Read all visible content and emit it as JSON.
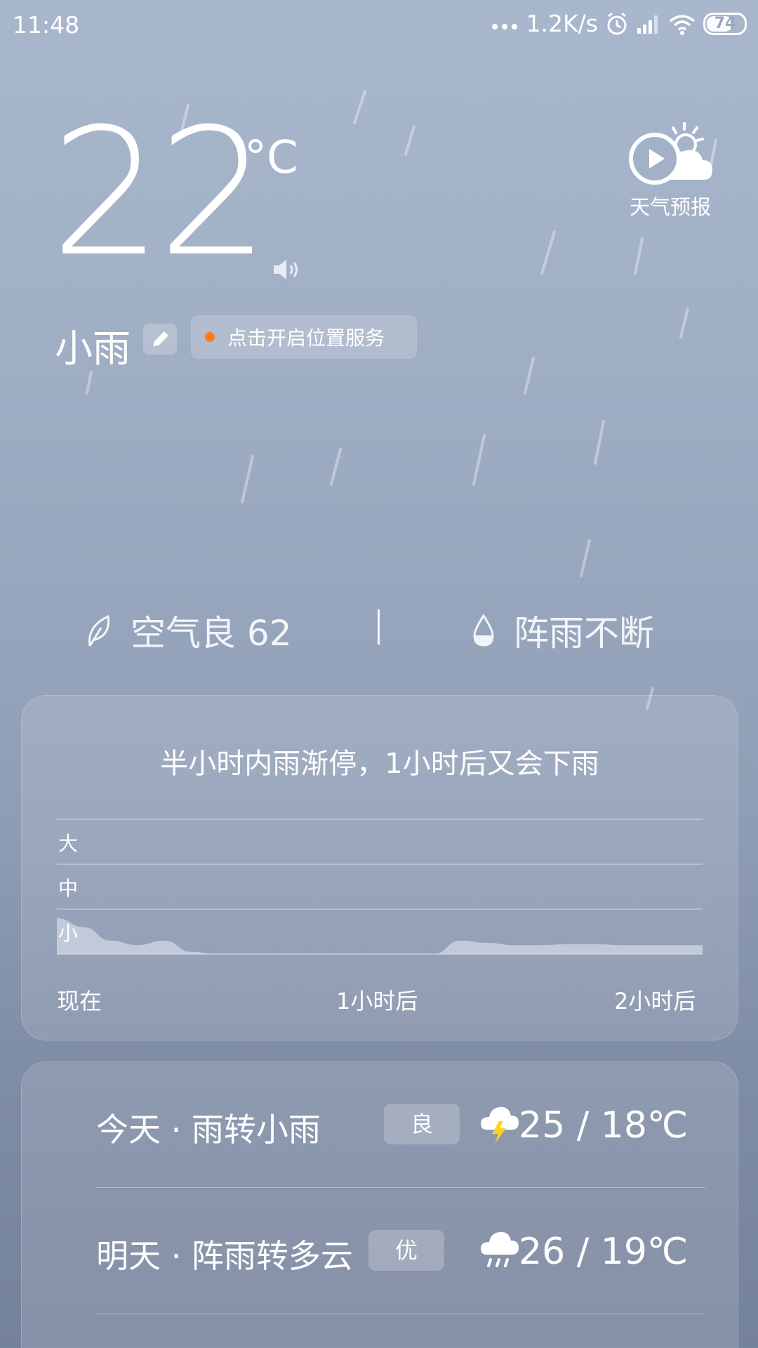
{
  "status_bar": {
    "time": "11:48",
    "network_speed": "1.2K/s",
    "battery": "74",
    "battery_level": 0.74,
    "icons": [
      "more-dots-icon",
      "alarm-icon",
      "signal-icon",
      "wifi-icon",
      "battery-icon"
    ]
  },
  "current": {
    "temperature": "22",
    "unit": "°C",
    "condition": "小雨",
    "location_button": "点击开启位置服务"
  },
  "forecast_button": {
    "label": "天气预报",
    "icon": "play-cloud-sun-icon"
  },
  "air_quality": {
    "label": "空气良 62",
    "icon": "leaf-icon"
  },
  "precip": {
    "label": "阵雨不断",
    "icon": "drop-icon"
  },
  "rain_card": {
    "summary": "半小时内雨渐停，1小时后又会下雨",
    "y_levels": [
      "大",
      "中",
      "小"
    ],
    "x_labels": [
      "现在",
      "1小时后",
      "2小时后"
    ]
  },
  "chart_data": {
    "type": "area",
    "title": "半小时内雨渐停，1小时后又会下雨",
    "x_ticks": [
      "现在",
      "1小时后",
      "2小时后"
    ],
    "y_ticks": [
      "小",
      "中",
      "大"
    ],
    "ylim": [
      0,
      3
    ],
    "x": [
      0,
      5,
      10,
      15,
      20,
      25,
      30,
      35,
      40,
      45,
      50,
      55,
      60,
      65,
      70,
      75,
      80,
      85,
      90,
      95,
      100,
      105,
      110,
      115,
      120
    ],
    "values": [
      0.8,
      0.6,
      0.3,
      0.2,
      0.3,
      0.05,
      0,
      0,
      0,
      0,
      0,
      0,
      0,
      0,
      0,
      0.3,
      0.25,
      0.2,
      0.2,
      0.22,
      0.22,
      0.2,
      0.2,
      0.2,
      0.2
    ],
    "grid": true,
    "color": "#c9d1df"
  },
  "daily": [
    {
      "label": "今天 · 雨转小雨",
      "aqi": "良",
      "icon": "thunder-cloud-icon",
      "temps": "25  /  18℃"
    },
    {
      "label": "明天 · 阵雨转多云",
      "aqi": "优",
      "icon": "rain-cloud-icon",
      "temps": "26  /  19℃"
    }
  ],
  "colors": {
    "background_top": "#a9b7cd",
    "background_bottom": "#75829b",
    "location_dot": "#ff7a1a",
    "lightning": "#ffd21f"
  }
}
